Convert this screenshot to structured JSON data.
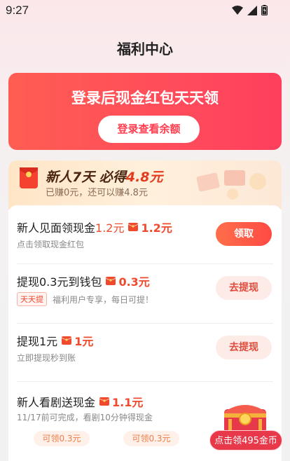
{
  "status_bar": {
    "time": "9:27"
  },
  "page": {
    "title": "福利中心"
  },
  "banner": {
    "title": "登录后现金红包天天领",
    "button_label": "登录查看余额"
  },
  "newbie": {
    "title_prefix": "新人7天 ",
    "title_bold": "必得",
    "title_amount": "4.8元",
    "subtitle": "已赚0元，还可以赚4.8元"
  },
  "tasks": [
    {
      "title": "新人见面领现金",
      "title_amount": "1.2元",
      "reward": "1.2元",
      "desc": "点击领取现金红包",
      "tag": "",
      "button": "领取"
    },
    {
      "title": "提现0.3元到钱包",
      "title_amount": "",
      "reward": "0.3元",
      "desc": "福利用户专享，每日可提！",
      "tag": "天天提",
      "button": "去提现"
    },
    {
      "title": "提现1元",
      "title_amount": "",
      "reward": "1元",
      "desc": "立即提现秒到账",
      "tag": "",
      "button": "去提现"
    },
    {
      "title": "新人看剧送现金",
      "title_amount": "",
      "reward": "1.1元",
      "desc": "11/17前可完成，看剧10分钟得现金",
      "tag": "",
      "button": ""
    }
  ],
  "chips": [
    "可领0.3元",
    "可领0.3元"
  ],
  "float_widget": {
    "label": "点击领495金币"
  },
  "colors": {
    "accent": "#ff4c5b",
    "reward_red": "#f04a2e",
    "chip_orange": "#ef7d47"
  }
}
